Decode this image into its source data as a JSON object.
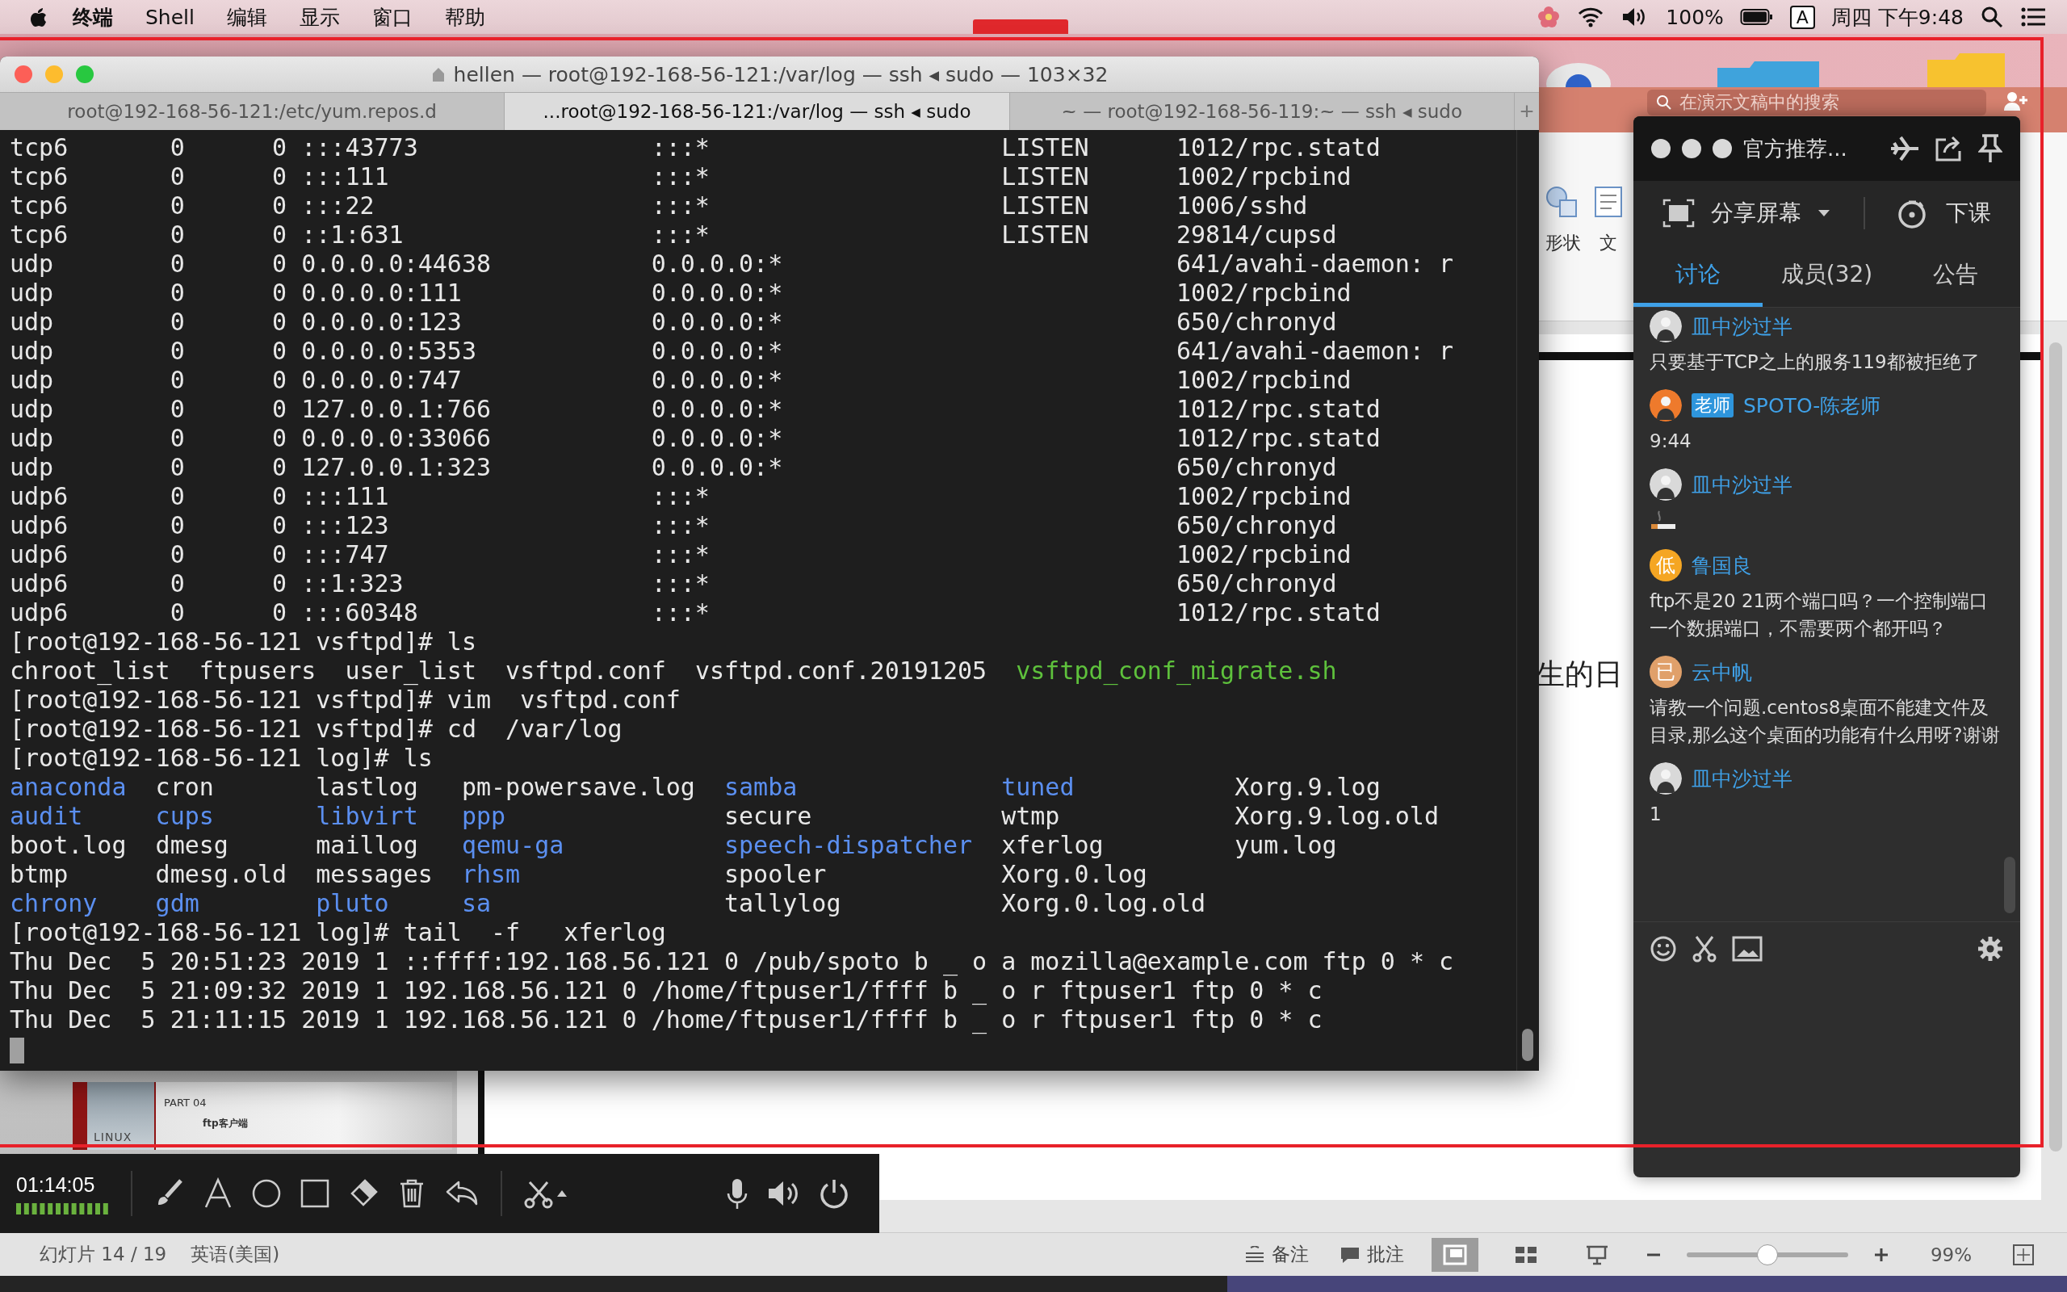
{
  "menu_bar": {
    "app_menus": [
      "终端",
      "Shell",
      "编辑",
      "显示",
      "窗口",
      "帮助"
    ],
    "battery": "100%",
    "input_source": "A",
    "clock": "周四 下午9:48"
  },
  "terminal": {
    "title": "hellen — root@192-168-56-121:/var/log — ssh ◂ sudo — 103×32",
    "tabs": [
      {
        "label": "root@192-168-56-121:/etc/yum.repos.d",
        "selected": false
      },
      {
        "label": "...root@192-168-56-121:/var/log — ssh ◂ sudo",
        "selected": true
      },
      {
        "label": "~ — root@192-168-56-119:~ — ssh ◂ sudo",
        "selected": false
      }
    ],
    "new_tab": "+",
    "lines": [
      {
        "kind": "socket",
        "proto": "tcp6",
        "recv_q": "0",
        "send_q": "0",
        "local": ":::43773",
        "foreign": ":::*",
        "state": "LISTEN",
        "program": "1012/rpc.statd"
      },
      {
        "kind": "socket",
        "proto": "tcp6",
        "recv_q": "0",
        "send_q": "0",
        "local": ":::111",
        "foreign": ":::*",
        "state": "LISTEN",
        "program": "1002/rpcbind"
      },
      {
        "kind": "socket",
        "proto": "tcp6",
        "recv_q": "0",
        "send_q": "0",
        "local": ":::22",
        "foreign": ":::*",
        "state": "LISTEN",
        "program": "1006/sshd"
      },
      {
        "kind": "socket",
        "proto": "tcp6",
        "recv_q": "0",
        "send_q": "0",
        "local": "::1:631",
        "foreign": ":::*",
        "state": "LISTEN",
        "program": "29814/cupsd"
      },
      {
        "kind": "socket",
        "proto": "udp",
        "recv_q": "0",
        "send_q": "0",
        "local": "0.0.0.0:44638",
        "foreign": "0.0.0.0:*",
        "program": "641/avahi-daemon: r"
      },
      {
        "kind": "socket",
        "proto": "udp",
        "recv_q": "0",
        "send_q": "0",
        "local": "0.0.0.0:111",
        "foreign": "0.0.0.0:*",
        "program": "1002/rpcbind"
      },
      {
        "kind": "socket",
        "proto": "udp",
        "recv_q": "0",
        "send_q": "0",
        "local": "0.0.0.0:123",
        "foreign": "0.0.0.0:*",
        "program": "650/chronyd"
      },
      {
        "kind": "socket",
        "proto": "udp",
        "recv_q": "0",
        "send_q": "0",
        "local": "0.0.0.0:5353",
        "foreign": "0.0.0.0:*",
        "program": "641/avahi-daemon: r"
      },
      {
        "kind": "socket",
        "proto": "udp",
        "recv_q": "0",
        "send_q": "0",
        "local": "0.0.0.0:747",
        "foreign": "0.0.0.0:*",
        "program": "1002/rpcbind"
      },
      {
        "kind": "socket",
        "proto": "udp",
        "recv_q": "0",
        "send_q": "0",
        "local": "127.0.0.1:766",
        "foreign": "0.0.0.0:*",
        "program": "1012/rpc.statd"
      },
      {
        "kind": "socket",
        "proto": "udp",
        "recv_q": "0",
        "send_q": "0",
        "local": "0.0.0.0:33066",
        "foreign": "0.0.0.0:*",
        "program": "1012/rpc.statd"
      },
      {
        "kind": "socket",
        "proto": "udp",
        "recv_q": "0",
        "send_q": "0",
        "local": "127.0.0.1:323",
        "foreign": "0.0.0.0:*",
        "program": "650/chronyd"
      },
      {
        "kind": "socket",
        "proto": "udp6",
        "recv_q": "0",
        "send_q": "0",
        "local": ":::111",
        "foreign": ":::*",
        "program": "1002/rpcbind"
      },
      {
        "kind": "socket",
        "proto": "udp6",
        "recv_q": "0",
        "send_q": "0",
        "local": ":::123",
        "foreign": ":::*",
        "program": "650/chronyd"
      },
      {
        "kind": "socket",
        "proto": "udp6",
        "recv_q": "0",
        "send_q": "0",
        "local": ":::747",
        "foreign": ":::*",
        "program": "1002/rpcbind"
      },
      {
        "kind": "socket",
        "proto": "udp6",
        "recv_q": "0",
        "send_q": "0",
        "local": "::1:323",
        "foreign": ":::*",
        "program": "650/chronyd"
      },
      {
        "kind": "socket",
        "proto": "udp6",
        "recv_q": "0",
        "send_q": "0",
        "local": ":::60348",
        "foreign": ":::*",
        "program": "1012/rpc.statd"
      },
      {
        "kind": "text",
        "text": "[root@192-168-56-121 vsftpd]# ls"
      },
      {
        "kind": "listing",
        "entries": [
          {
            "name": "chroot_list",
            "kind": "file"
          },
          {
            "name": "ftpusers",
            "kind": "file"
          },
          {
            "name": "user_list",
            "kind": "file"
          },
          {
            "name": "vsftpd.conf",
            "kind": "file"
          },
          {
            "name": "vsftpd.conf.20191205",
            "kind": "file"
          },
          {
            "name": "vsftpd_conf_migrate.sh",
            "kind": "exec"
          }
        ]
      },
      {
        "kind": "text",
        "text": "[root@192-168-56-121 vsftpd]# vim  vsftpd.conf"
      },
      {
        "kind": "text",
        "text": "[root@192-168-56-121 vsftpd]# cd  /var/log"
      },
      {
        "kind": "text",
        "text": "[root@192-168-56-121 log]# ls"
      },
      {
        "kind": "columns",
        "entries": [
          {
            "name": "anaconda",
            "kind": "dir"
          },
          {
            "name": "cron",
            "kind": "file"
          },
          {
            "name": "lastlog",
            "kind": "file"
          },
          {
            "name": "pm-powersave.log",
            "kind": "file"
          },
          {
            "name": "samba",
            "kind": "dir"
          },
          {
            "name": "tuned",
            "kind": "dir"
          },
          {
            "name": "Xorg.9.log",
            "kind": "file"
          }
        ]
      },
      {
        "kind": "columns",
        "entries": [
          {
            "name": "audit",
            "kind": "dir"
          },
          {
            "name": "cups",
            "kind": "dir"
          },
          {
            "name": "libvirt",
            "kind": "dir"
          },
          {
            "name": "ppp",
            "kind": "dir"
          },
          {
            "name": "secure",
            "kind": "file"
          },
          {
            "name": "wtmp",
            "kind": "file"
          },
          {
            "name": "Xorg.9.log.old",
            "kind": "file"
          }
        ]
      },
      {
        "kind": "columns",
        "entries": [
          {
            "name": "boot.log",
            "kind": "file"
          },
          {
            "name": "dmesg",
            "kind": "file"
          },
          {
            "name": "maillog",
            "kind": "file"
          },
          {
            "name": "qemu-ga",
            "kind": "dir"
          },
          {
            "name": "speech-dispatcher",
            "kind": "dir"
          },
          {
            "name": "xferlog",
            "kind": "file"
          },
          {
            "name": "yum.log",
            "kind": "file"
          }
        ]
      },
      {
        "kind": "columns",
        "entries": [
          {
            "name": "btmp",
            "kind": "file"
          },
          {
            "name": "dmesg.old",
            "kind": "file"
          },
          {
            "name": "messages",
            "kind": "file"
          },
          {
            "name": "rhsm",
            "kind": "dir"
          },
          {
            "name": "spooler",
            "kind": "file"
          },
          {
            "name": "Xorg.0.log",
            "kind": "file"
          }
        ]
      },
      {
        "kind": "columns",
        "entries": [
          {
            "name": "chrony",
            "kind": "dir"
          },
          {
            "name": "gdm",
            "kind": "dir"
          },
          {
            "name": "pluto",
            "kind": "dir"
          },
          {
            "name": "sa",
            "kind": "dir"
          },
          {
            "name": "tallylog",
            "kind": "file"
          },
          {
            "name": "Xorg.0.log.old",
            "kind": "file"
          }
        ]
      },
      {
        "kind": "text",
        "text": "[root@192-168-56-121 log]# tail  -f   xferlog"
      },
      {
        "kind": "text",
        "text": "Thu Dec  5 20:51:23 2019 1 ::ffff:192.168.56.121 0 /pub/spoto b _ o a mozilla@example.com ftp 0 * c"
      },
      {
        "kind": "text",
        "text": "Thu Dec  5 21:09:32 2019 1 192.168.56.121 0 /home/ftpuser1/ffff b _ o r ftpuser1 ftp 0 * c"
      },
      {
        "kind": "text",
        "text": "Thu Dec  5 21:11:15 2019 1 192.168.56.121 0 /home/ftpuser1/ffff b _ o r ftpuser1 ftp 0 * c"
      },
      {
        "kind": "cursor"
      }
    ]
  },
  "presentation": {
    "search": {
      "placeholder": "在演示文稿中的搜索"
    },
    "ribbon_items": [
      "形状",
      "文"
    ],
    "slide_text": "生的日",
    "thumbnail": {
      "part": "PART 04",
      "logo": "LINUX",
      "title": "ftp客户端"
    },
    "status_bar": {
      "slide_position": "幻灯片 14 / 19",
      "language": "英语(美国)",
      "notes": "备注",
      "comments": "批注",
      "views": [
        {
          "kind": "normal",
          "selected": true
        },
        {
          "kind": "sorter",
          "selected": false
        },
        {
          "kind": "slideshow",
          "selected": false
        }
      ],
      "zoom": {
        "level": 0.5,
        "reading": "99%"
      }
    }
  },
  "recorder": {
    "timer": "01:14:05"
  },
  "chat": {
    "title": "官方推荐...",
    "share_label": "分享屏幕",
    "end_label": "下课",
    "tabs": [
      {
        "label": "讨论",
        "selected": true
      },
      {
        "label": "成员(32)",
        "selected": false
      },
      {
        "label": "公告",
        "selected": false
      }
    ],
    "messages": [
      {
        "user": "皿中沙过半",
        "avatar": {
          "kind": "photo",
          "color": "#d9d9d9"
        },
        "content": {
          "kind": "text",
          "text": "只要基于TCP之上的服务119都被拒绝了"
        }
      },
      {
        "user": "SPOTO-陈老师",
        "badge": "老师",
        "avatar": {
          "kind": "photo",
          "color": "#ee7a2c"
        },
        "content": {
          "kind": "text",
          "text": "9:44"
        }
      },
      {
        "user": "皿中沙过半",
        "avatar": {
          "kind": "photo",
          "color": "#d9d9d9"
        },
        "content": {
          "kind": "sticker"
        }
      },
      {
        "user": "鲁国良",
        "avatar": {
          "kind": "letter",
          "letter": "低",
          "color": "#f5a623"
        },
        "content": {
          "kind": "text",
          "text": "ftp不是20 21两个端口吗？一个控制端口一个数据端口，不需要两个都开吗？"
        }
      },
      {
        "user": "云中帆",
        "avatar": {
          "kind": "letter",
          "letter": "已",
          "color": "#e0a06a"
        },
        "content": {
          "kind": "text",
          "text": "请教一个问题.centos8桌面不能建文件及目录,那么这个桌面的功能有什么用呀?谢谢"
        }
      },
      {
        "user": "皿中沙过半",
        "avatar": {
          "kind": "photo",
          "color": "#d9d9d9"
        },
        "content": {
          "kind": "text",
          "text": "1"
        }
      }
    ]
  }
}
